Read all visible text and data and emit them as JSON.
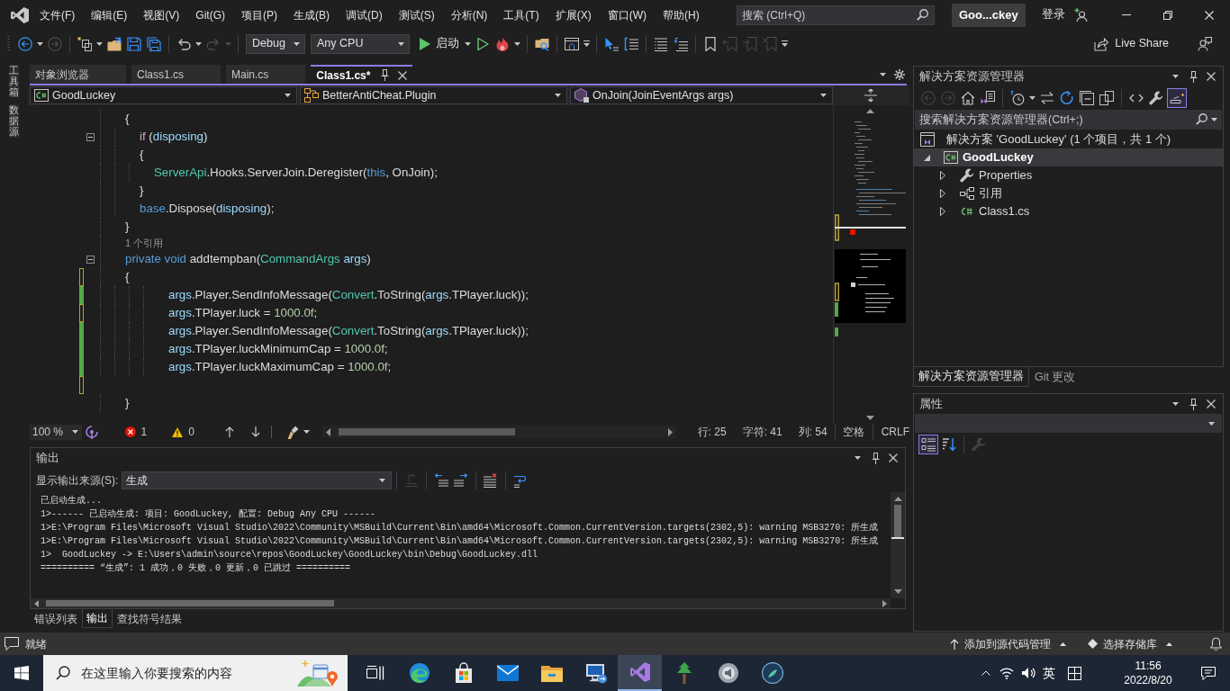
{
  "menu_bar": {
    "items": [
      "文件(F)",
      "编辑(E)",
      "视图(V)",
      "Git(G)",
      "项目(P)",
      "生成(B)",
      "调试(D)",
      "测试(S)",
      "分析(N)",
      "工具(T)",
      "扩展(X)",
      "窗口(W)",
      "帮助(H)"
    ],
    "search": {
      "placeholder": "搜索 (Ctrl+Q)"
    },
    "solution_name": "Goo...ckey",
    "sign_in": "登录"
  },
  "toolbar": {
    "groups": [
      [
        {
          "kind": "back",
          "disabled": false
        },
        {
          "kind": "caret",
          "disabled": false
        },
        {
          "kind": "forward",
          "disabled": true
        }
      ],
      [
        {
          "kind": "new_item",
          "disabled": false
        },
        {
          "kind": "caret",
          "disabled": false
        },
        {
          "kind": "open",
          "disabled": false
        },
        {
          "kind": "save",
          "disabled": false
        },
        {
          "kind": "save_all",
          "disabled": false
        }
      ],
      [
        {
          "kind": "undo",
          "disabled": false
        },
        {
          "kind": "caret",
          "disabled": false
        },
        {
          "kind": "redo",
          "disabled": true
        },
        {
          "kind": "caret",
          "disabled": true
        }
      ],
      [
        {
          "kind": "combo",
          "value": "Debug",
          "disabled": false
        },
        {
          "kind": "combo",
          "value": "Any CPU",
          "disabled": false
        },
        {
          "kind": "start",
          "label": "启动",
          "disabled": false
        },
        {
          "kind": "caret",
          "disabled": false
        },
        {
          "kind": "run",
          "disabled": false
        },
        {
          "kind": "hot_reload",
          "disabled": false
        },
        {
          "kind": "caret",
          "disabled": false
        }
      ],
      [
        {
          "kind": "find_in_files",
          "disabled": false
        }
      ],
      [
        {
          "kind": "layout",
          "disabled": false
        },
        {
          "kind": "overflow",
          "disabled": false
        }
      ],
      [
        {
          "kind": "pointer",
          "disabled": false
        },
        {
          "kind": "format",
          "disabled": false
        }
      ],
      [
        {
          "kind": "indent",
          "disabled": false
        },
        {
          "kind": "outdent",
          "disabled": false
        }
      ],
      [
        {
          "kind": "bookmark",
          "disabled": false
        },
        {
          "kind": "prev_bookmark",
          "disabled": true
        },
        {
          "kind": "next_bookmark",
          "disabled": true
        },
        {
          "kind": "clear_bookmark",
          "disabled": true
        },
        {
          "kind": "overflow",
          "disabled": false
        }
      ]
    ],
    "live_share": "Live Share"
  },
  "side_tabs": [
    "工具箱",
    "数据源"
  ],
  "document_tabs": [
    {
      "label": "对象浏览器",
      "selected": false
    },
    {
      "label": "Class1.cs",
      "selected": false
    },
    {
      "label": "Main.cs",
      "selected": false
    },
    {
      "label": "Class1.cs*",
      "selected": true
    }
  ],
  "navigation_bar": {
    "project": "GoodLuckey",
    "type": "BetterAntiCheat.Plugin",
    "member": "OnJoin(JoinEventArgs args)"
  },
  "code": {
    "lines": [
      {
        "kind": "code",
        "fold": false,
        "saved_change": false,
        "unsaved_change": false,
        "tokens": [
          {
            "text": "        {",
            "kind": "plain"
          }
        ]
      },
      {
        "kind": "code",
        "fold": true,
        "saved_change": false,
        "unsaved_change": false,
        "tokens": [
          {
            "text": "            if",
            "kind": "control"
          },
          {
            "text": " (",
            "kind": "plain"
          },
          {
            "text": "disposing",
            "kind": "param"
          },
          {
            "text": ")",
            "kind": "plain"
          }
        ]
      },
      {
        "kind": "code",
        "fold": false,
        "saved_change": false,
        "unsaved_change": false,
        "tokens": [
          {
            "text": "            {",
            "kind": "plain"
          }
        ]
      },
      {
        "kind": "code",
        "fold": false,
        "saved_change": false,
        "unsaved_change": false,
        "tokens": [
          {
            "text": "                ServerApi",
            "kind": "type"
          },
          {
            "text": ".Hooks.ServerJoin.Deregister(",
            "kind": "plain"
          },
          {
            "text": "this",
            "kind": "keyword"
          },
          {
            "text": ", OnJoin);",
            "kind": "plain"
          }
        ]
      },
      {
        "kind": "code",
        "fold": false,
        "saved_change": false,
        "unsaved_change": false,
        "tokens": [
          {
            "text": "            }",
            "kind": "plain"
          }
        ]
      },
      {
        "kind": "code",
        "fold": false,
        "saved_change": false,
        "unsaved_change": false,
        "tokens": [
          {
            "text": "            base",
            "kind": "keyword"
          },
          {
            "text": ".Dispose(",
            "kind": "plain"
          },
          {
            "text": "disposing",
            "kind": "param"
          },
          {
            "text": ");",
            "kind": "plain"
          }
        ]
      },
      {
        "kind": "code",
        "fold": false,
        "saved_change": false,
        "unsaved_change": false,
        "tokens": [
          {
            "text": "        }",
            "kind": "plain"
          }
        ]
      },
      {
        "kind": "codelens",
        "fold": false,
        "saved_change": false,
        "unsaved_change": false,
        "text": "        1 个引用"
      },
      {
        "kind": "code",
        "fold": true,
        "saved_change": false,
        "unsaved_change": false,
        "tokens": [
          {
            "text": "        private void",
            "kind": "keyword"
          },
          {
            "text": " addtempban(",
            "kind": "plain"
          },
          {
            "text": "CommandArgs",
            "kind": "type"
          },
          {
            "text": " args",
            "kind": "param"
          },
          {
            "text": ")",
            "kind": "plain"
          }
        ]
      },
      {
        "kind": "code",
        "fold": false,
        "saved_change": false,
        "unsaved_change": true,
        "tokens": [
          {
            "text": "        {",
            "kind": "plain"
          }
        ]
      },
      {
        "kind": "code",
        "fold": false,
        "saved_change": true,
        "unsaved_change": false,
        "tokens": [
          {
            "text": "                    args",
            "kind": "param"
          },
          {
            "text": ".Player.SendInfoMessage(",
            "kind": "plain"
          },
          {
            "text": "Convert",
            "kind": "type"
          },
          {
            "text": ".ToString(",
            "kind": "plain"
          },
          {
            "text": "args",
            "kind": "param"
          },
          {
            "text": ".TPlayer.luck));",
            "kind": "plain"
          }
        ]
      },
      {
        "kind": "code",
        "fold": false,
        "saved_change": false,
        "unsaved_change": true,
        "tokens": [
          {
            "text": "                    args",
            "kind": "param"
          },
          {
            "text": ".TPlayer.luck = ",
            "kind": "plain"
          },
          {
            "text": "1000.0f",
            "kind": "number"
          },
          {
            "text": ";",
            "kind": "plain"
          }
        ]
      },
      {
        "kind": "code",
        "fold": false,
        "saved_change": true,
        "unsaved_change": false,
        "tokens": [
          {
            "text": "                    args",
            "kind": "param"
          },
          {
            "text": ".Player.SendInfoMessage(",
            "kind": "plain"
          },
          {
            "text": "Convert",
            "kind": "type"
          },
          {
            "text": ".ToString(",
            "kind": "plain"
          },
          {
            "text": "args",
            "kind": "param"
          },
          {
            "text": ".TPlayer.luck));",
            "kind": "plain"
          }
        ]
      },
      {
        "kind": "code",
        "fold": false,
        "saved_change": true,
        "unsaved_change": false,
        "tokens": [
          {
            "text": "                    args",
            "kind": "param"
          },
          {
            "text": ".TPlayer.luckMinimumCap = ",
            "kind": "plain"
          },
          {
            "text": "1000.0f",
            "kind": "number"
          },
          {
            "text": ";",
            "kind": "plain"
          }
        ]
      },
      {
        "kind": "code",
        "fold": false,
        "saved_change": true,
        "unsaved_change": false,
        "tokens": [
          {
            "text": "                    args",
            "kind": "param"
          },
          {
            "text": ".TPlayer.luckMaximumCap = ",
            "kind": "plain"
          },
          {
            "text": "1000.0f",
            "kind": "number"
          },
          {
            "text": ";",
            "kind": "plain"
          }
        ]
      },
      {
        "kind": "blank",
        "fold": false,
        "saved_change": false,
        "unsaved_change": true
      },
      {
        "kind": "code",
        "fold": false,
        "saved_change": false,
        "unsaved_change": false,
        "tokens": [
          {
            "text": "        }",
            "kind": "plain"
          }
        ]
      }
    ]
  },
  "editor_status": {
    "zoom": "100 %",
    "errors": "1",
    "warnings": "0",
    "line": "行: 25",
    "character": "字符: 41",
    "column": "列: 54",
    "indentation": "空格",
    "line_ending": "CRLF"
  },
  "output": {
    "title": "输出",
    "source_label": "显示输出来源(S):",
    "source": "生成",
    "toolbar": [
      {
        "kind": "go_to_line",
        "disabled": true
      },
      {
        "kind": "previous_message",
        "disabled": false
      },
      {
        "kind": "next_message",
        "disabled": false
      },
      {
        "kind": "clear_all",
        "disabled": false
      },
      {
        "kind": "word_wrap",
        "disabled": false
      }
    ],
    "lines": [
      "已启动生成...",
      "1>------ 已启动生成: 项目: GoodLuckey, 配置: Debug Any CPU ------",
      "1>E:\\Program Files\\Microsoft Visual Studio\\2022\\Community\\MSBuild\\Current\\Bin\\amd64\\Microsoft.Common.CurrentVersion.targets(2302,5): warning MSB3270: 所生成",
      "1>E:\\Program Files\\Microsoft Visual Studio\\2022\\Community\\MSBuild\\Current\\Bin\\amd64\\Microsoft.Common.CurrentVersion.targets(2302,5): warning MSB3270: 所生成",
      "1>  GoodLuckey -> E:\\Users\\admin\\source\\repos\\GoodLuckey\\GoodLuckey\\bin\\Debug\\GoodLuckey.dll",
      "========== “生成”: 1 成功，0 失败，0 更新，0 已跳过 =========="
    ]
  },
  "output_tabs": [
    {
      "label": "错误列表",
      "selected": false
    },
    {
      "label": "输出",
      "selected": true
    },
    {
      "label": "查找符号结果",
      "selected": false
    }
  ],
  "solution_explorer": {
    "title": "解决方案资源管理器",
    "toolbar": [
      [
        {
          "kind": "back",
          "disabled": true,
          "on": false
        },
        {
          "kind": "forward",
          "disabled": true,
          "on": false
        },
        {
          "kind": "home",
          "disabled": false,
          "on": false
        },
        {
          "kind": "switch_views",
          "disabled": false,
          "on": false
        }
      ],
      [
        {
          "kind": "history",
          "disabled": false,
          "on": false
        },
        {
          "kind": "caret",
          "disabled": false,
          "on": false
        },
        {
          "kind": "sync",
          "disabled": false,
          "on": false
        },
        {
          "kind": "refresh",
          "disabled": false,
          "on": false
        },
        {
          "kind": "collapse_all",
          "disabled": false,
          "on": false
        },
        {
          "kind": "show_all",
          "disabled": false,
          "on": false
        }
      ],
      [
        {
          "kind": "view_code",
          "disabled": false,
          "on": false
        },
        {
          "kind": "properties",
          "disabled": false,
          "on": false
        },
        {
          "kind": "preview",
          "disabled": false,
          "on": true
        }
      ]
    ],
    "search": {
      "placeholder": "搜索解决方案资源管理器(Ctrl+;)"
    },
    "tree": [
      {
        "kind": "solution",
        "label": "解决方案 'GoodLuckey' (1 个项目，共 1 个)",
        "selected": false,
        "children": [
          {
            "kind": "project",
            "label": "GoodLuckey",
            "expanded": true,
            "selected": true,
            "children": [
              {
                "kind": "properties_folder",
                "label": "Properties",
                "expanded": false,
                "selected": false
              },
              {
                "kind": "references",
                "label": "引用",
                "expanded": false,
                "selected": false
              },
              {
                "kind": "csharp_file",
                "label": "Class1.cs",
                "expanded": false,
                "selected": false
              }
            ]
          }
        ]
      }
    ],
    "tabs": [
      {
        "label": "解决方案资源管理器",
        "selected": true
      },
      {
        "label": "Git 更改",
        "selected": false
      }
    ]
  },
  "properties": {
    "title": "属性",
    "toolbar": [
      {
        "kind": "categorized",
        "disabled": false,
        "on": true
      },
      {
        "kind": "alphabetical",
        "disabled": false,
        "on": false
      },
      {
        "kind": "property_pages",
        "disabled": true,
        "on": false
      }
    ]
  },
  "status_bar": {
    "message": "就绪",
    "source_control": "添加到源代码管理",
    "repository": "选择存储库"
  },
  "taskbar": {
    "search": {
      "placeholder": "在这里输入你要搜索的内容"
    },
    "apps": [
      {
        "kind": "task_view",
        "active": false
      },
      {
        "kind": "edge",
        "active": false
      },
      {
        "kind": "store",
        "active": false
      },
      {
        "kind": "mail",
        "active": false
      },
      {
        "kind": "explorer",
        "active": false
      },
      {
        "kind": "remote_desktop",
        "active": false
      },
      {
        "kind": "visual_studio",
        "active": true
      },
      {
        "kind": "tree",
        "active": false
      },
      {
        "kind": "sound",
        "active": false
      },
      {
        "kind": "game",
        "active": false
      }
    ],
    "input_method": "英",
    "time": "11:56",
    "date": "2022/8/20"
  }
}
